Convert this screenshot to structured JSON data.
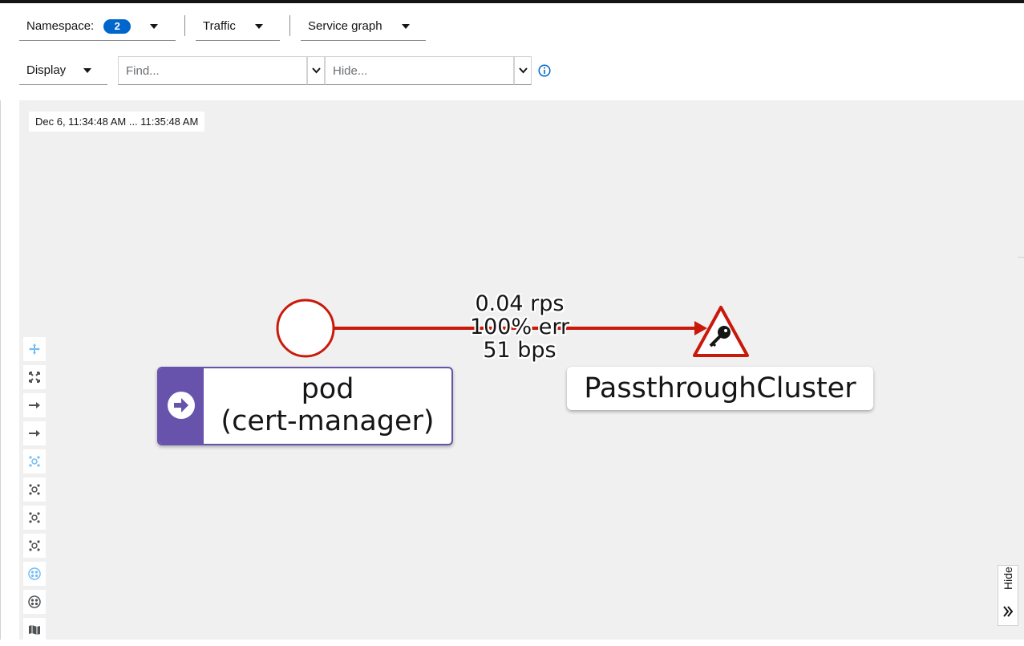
{
  "toolbar": {
    "namespace_label": "Namespace:",
    "namespace_count": "2",
    "traffic_label": "Traffic",
    "graph_type_label": "Service graph",
    "display_label": "Display",
    "find_placeholder": "Find...",
    "hide_placeholder": "Hide..."
  },
  "graph": {
    "timestamp": "Dec 6, 11:34:48 AM ... 11:35:48 AM",
    "source_node": {
      "line1": "pod",
      "line2": "(cert-manager)"
    },
    "target_node": {
      "label": "PassthroughCluster"
    },
    "edge": {
      "rps": "0.04 rps",
      "err": "100% err",
      "bps": "51 bps"
    },
    "edge_color": "#c9190b",
    "badge_color": "#6753ac"
  },
  "side_toolbar": {
    "icons": [
      "pan-icon",
      "fit-icon",
      "layout-lr-icon",
      "layout-tb-icon",
      "layout-cola-icon",
      "layout-dagre-icon",
      "layout-cose-icon",
      "layout-grid-icon",
      "namespace-box-icon",
      "legend-group-icon",
      "map-icon"
    ]
  },
  "side_panel": {
    "hide_label": "Hide"
  }
}
